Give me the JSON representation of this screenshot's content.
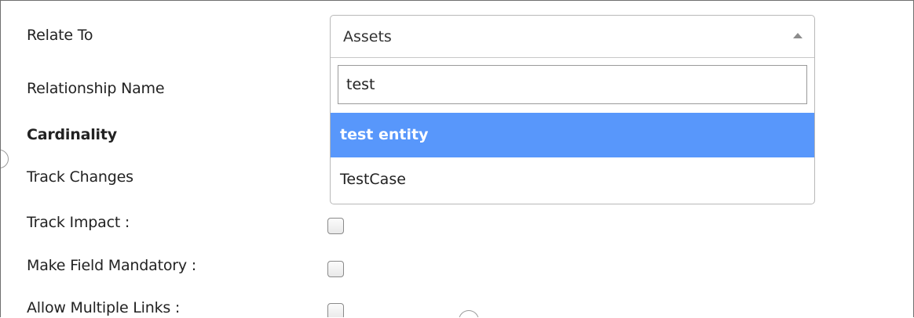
{
  "form": {
    "labels": {
      "relate_to": "Relate To",
      "relationship_name": "Relationship Name",
      "cardinality": "Cardinality",
      "track_changes": "Track Changes",
      "track_impact": "Track Impact :",
      "make_field_mandatory": "Make Field Mandatory :",
      "allow_multiple_links": "Allow Multiple Links :"
    },
    "checkboxes": {
      "track_impact": false,
      "make_field_mandatory": false,
      "allow_multiple_links": false
    }
  },
  "dropdown": {
    "selected_value": "Assets",
    "search_value": "test",
    "options": [
      {
        "label": "test entity",
        "highlighted": true
      },
      {
        "label": "TestCase",
        "highlighted": false
      }
    ],
    "highlight_color": "#5897fb"
  }
}
